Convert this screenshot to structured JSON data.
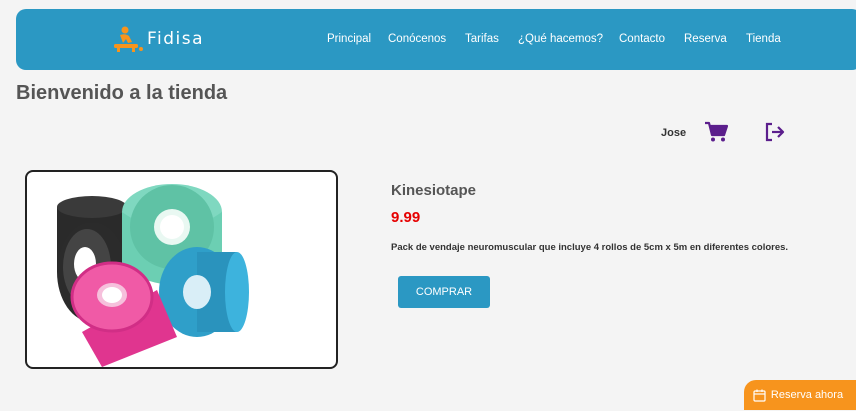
{
  "brand": {
    "name": "Fidisa",
    "logo_icon": "massage-person-icon"
  },
  "nav": {
    "items": [
      {
        "label": "Principal"
      },
      {
        "label": "Conócenos"
      },
      {
        "label": "Tarifas"
      },
      {
        "label": "¿Qué hacemos?"
      },
      {
        "label": "Contacto"
      },
      {
        "label": "Reserva"
      },
      {
        "label": "Tienda"
      }
    ]
  },
  "page": {
    "title": "Bienvenido a la tienda"
  },
  "user": {
    "name": "Jose",
    "cart_icon": "shopping-cart-icon",
    "logout_icon": "logout-icon"
  },
  "product": {
    "name": "Kinesiotape",
    "price": "9.99",
    "description": "Pack de vendaje neuromuscular que incluye 4 rollos de 5cm x 5m en diferentes colores.",
    "buy_label": "COMPRAR",
    "image_icon": "kinesiotape-rolls-image"
  },
  "reserve": {
    "label": "Reserva ahora",
    "icon": "calendar-icon"
  },
  "colors": {
    "primary": "#2b98c3",
    "accent": "#f7941d",
    "price": "#e60000",
    "icon": "#5b1e8c"
  }
}
